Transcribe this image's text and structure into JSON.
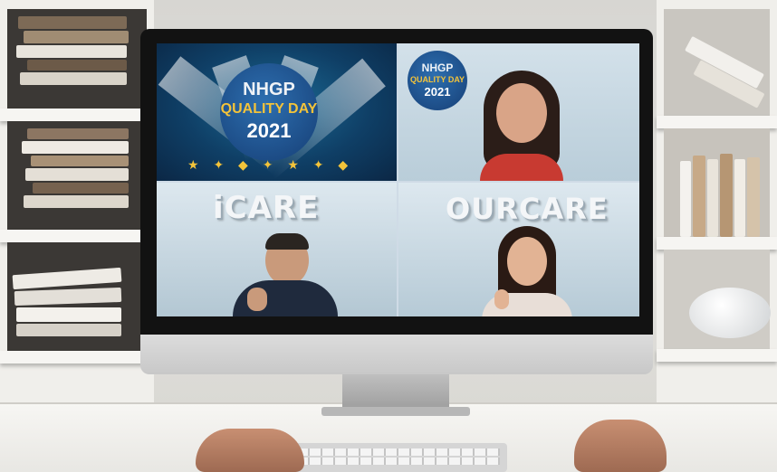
{
  "photo": {
    "subject": "Video conference on desktop monitor",
    "badge": {
      "line1": "NHGP",
      "line2": "QUALITY DAY",
      "line3": "2021"
    },
    "mini_badge": {
      "line1": "NHGP",
      "line2": "QUALITY DAY",
      "line3": "2021"
    },
    "tile3_logo": "iCARE",
    "tile4_logo": "OURCARE"
  },
  "colors": {
    "wall": "#d7d6d2",
    "monitor_bezel": "#121212",
    "badge_blue": "#163e75",
    "quality_pink": "#e2559a",
    "day_yellow": "#f3c33a"
  }
}
